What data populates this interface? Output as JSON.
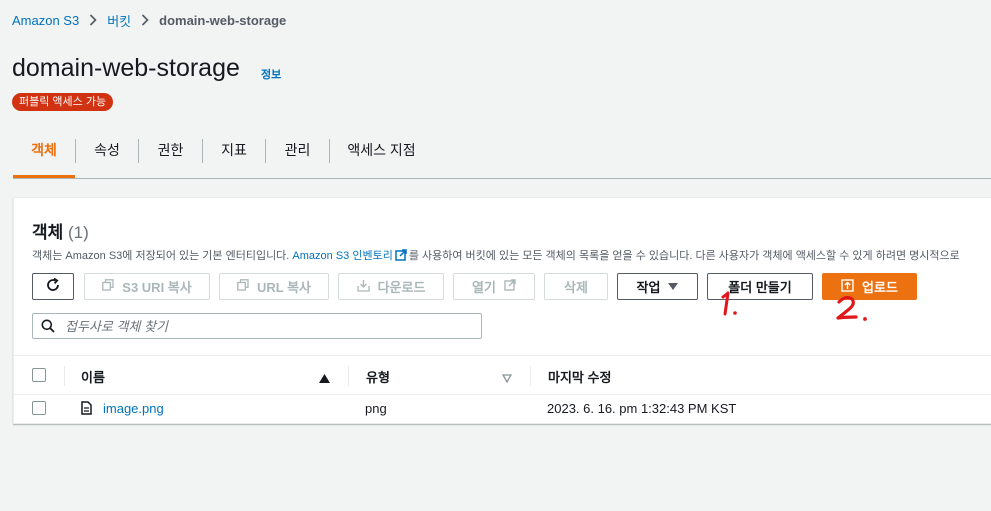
{
  "breadcrumb": {
    "root": "Amazon S3",
    "middle": "버킷",
    "current": "domain-web-storage"
  },
  "header": {
    "title": "domain-web-storage",
    "info": "정보",
    "badge": "퍼블릭 액세스 가능"
  },
  "tabs": [
    "객체",
    "속성",
    "권한",
    "지표",
    "관리",
    "액세스 지점"
  ],
  "objects": {
    "title": "객체",
    "count": "(1)",
    "desc_prefix": "객체는 Amazon S3에 저장되어 있는 기본 엔터티입니다. ",
    "desc_link": "Amazon S3 인벤토리",
    "desc_suffix": "를 사용하여 버킷에 있는 모든 객체의 목록을 얻을 수 있습니다. 다른 사용자가 객체에 액세스할 수 있게 하려면 명시적으로"
  },
  "toolbar": {
    "copy_s3_uri": "S3 URI 복사",
    "copy_url": "URL 복사",
    "download": "다운로드",
    "open": "열기",
    "delete": "삭제",
    "actions": "작업",
    "create_folder": "폴더 만들기",
    "upload": "업로드"
  },
  "search": {
    "placeholder": "접두사로 객체 찾기"
  },
  "table": {
    "columns": [
      "이름",
      "유형",
      "마지막 수정"
    ],
    "rows": [
      {
        "name": "image.png",
        "type": "png",
        "modified": "2023. 6. 16. pm 1:32:43 PM KST"
      }
    ]
  },
  "annotations": [
    "1.",
    "2."
  ],
  "colors": {
    "accent": "#ec7211",
    "link": "#0073bb",
    "badge": "#d13212",
    "annotation": "#e0171b"
  }
}
